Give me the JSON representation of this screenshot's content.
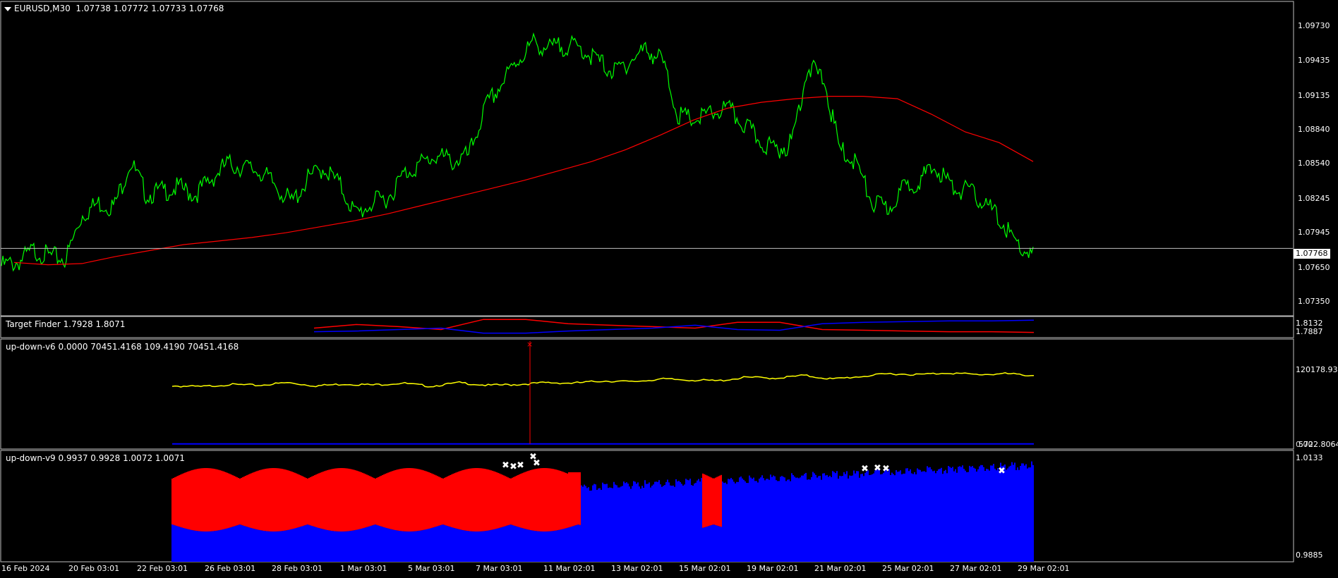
{
  "main": {
    "symbol": "EURUSD,M30",
    "ohlc": "1.07738 1.07772 1.07733 1.07768",
    "current_price": "1.07768",
    "price_ticks": [
      "1.09730",
      "1.09435",
      "1.09135",
      "1.08840",
      "1.08540",
      "1.08245",
      "1.07945",
      "1.07650",
      "1.07350"
    ]
  },
  "target_finder": {
    "label": "Target Finder 1.7928 1.8071",
    "ticks": [
      "1.8132",
      "1.7887"
    ]
  },
  "updown_v6": {
    "label": "up-down-v6 0.0000 70451.4168 109.4190 70451.4168",
    "ticks": [
      "120178.93",
      "5722.8064"
    ],
    "bottom_overlap": "0.00"
  },
  "updown_v9": {
    "label": "up-down-v9 0.9937 0.9928 1.0072 1.0071",
    "ticks": [
      "1.0133",
      "0.9885"
    ]
  },
  "time_axis": [
    "16 Feb 2024",
    "20 Feb 03:01",
    "22 Feb 03:01",
    "26 Feb 03:01",
    "28 Feb 03:01",
    "1 Mar 03:01",
    "5 Mar 03:01",
    "7 Mar 03:01",
    "11 Mar 02:01",
    "13 Mar 02:01",
    "15 Mar 02:01",
    "19 Mar 02:01",
    "21 Mar 02:01",
    "25 Mar 02:01",
    "27 Mar 02:01",
    "29 Mar 02:01"
  ],
  "colors": {
    "price": "#00ff00",
    "ma": "#ff0000",
    "yellow": "#ffff00",
    "blue": "#0000ff",
    "red": "#ff0000",
    "grid": "#c0c0c0"
  },
  "chart_data": [
    {
      "type": "line",
      "title": "EURUSD,M30",
      "ylim": [
        1.072,
        1.0985
      ],
      "series": [
        {
          "values": [
            1.0762,
            1.0765,
            1.0775,
            1.077,
            1.0768,
            1.0805,
            1.0815,
            1.0812,
            1.085,
            1.0822,
            1.0825,
            1.0828,
            1.0822,
            1.0835,
            1.0848,
            1.0845,
            1.0842,
            1.083,
            1.0815,
            1.0835,
            1.0845,
            1.083,
            1.0805,
            1.0815,
            1.082,
            1.084,
            1.0848,
            1.0855,
            1.085,
            1.0855,
            1.0895,
            1.0915,
            1.0935,
            1.095,
            1.0945,
            1.0948,
            1.0945,
            1.0935,
            1.0925,
            1.0935,
            1.0945,
            1.0935,
            1.0888,
            1.0885,
            1.089,
            1.0895,
            1.0882,
            1.0868,
            1.086,
            1.0865,
            1.093,
            1.092,
            1.086,
            1.085,
            1.0815,
            1.081,
            1.0828,
            1.0835,
            1.0845,
            1.0828,
            1.0825,
            1.0815,
            1.08,
            1.078,
            1.077
          ]
        },
        {
          "values": [
            1.0765,
            1.0763,
            1.0764,
            1.077,
            1.0775,
            1.078,
            1.0783,
            1.0786,
            1.079,
            1.0795,
            1.08,
            1.0806,
            1.0813,
            1.082,
            1.0827,
            1.0834,
            1.0842,
            1.085,
            1.086,
            1.0872,
            1.0885,
            1.0895,
            1.09,
            1.0903,
            1.0905,
            1.0905,
            1.0903,
            1.089,
            1.0875,
            1.0866,
            1.085
          ]
        }
      ]
    },
    {
      "type": "line",
      "title": "Target Finder 1.7928 1.8071",
      "ylim": [
        1.7887,
        1.8132
      ],
      "series": [
        {
          "values": [
            1.8,
            1.805,
            1.802,
            1.798,
            1.812,
            1.812,
            1.806,
            1.804,
            1.802,
            1.8,
            1.808,
            1.808,
            1.798,
            1.797,
            1.796,
            1.795,
            1.795,
            1.794
          ]
        },
        {
          "values": [
            1.795,
            1.796,
            1.798,
            1.8,
            1.793,
            1.793,
            1.796,
            1.798,
            1.8,
            1.804,
            1.798,
            1.797,
            1.806,
            1.808,
            1.809,
            1.81,
            1.81,
            1.811
          ]
        }
      ]
    },
    {
      "type": "line",
      "title": "up-down-v6 0.0000 70451.4168 109.4190 70451.4168",
      "ylim": [
        5722.8064,
        120178.93
      ],
      "series": [
        {
          "values": [
            70451,
            69500,
            72000,
            71000,
            74000,
            70500,
            72500,
            71500,
            73500,
            70000,
            74000,
            71000,
            72000,
            74000,
            73500,
            76000,
            75000,
            78000,
            77000,
            76000,
            80000,
            79000,
            82000,
            78000,
            81000,
            84000,
            83000,
            85000,
            83000,
            84000,
            82000
          ]
        },
        {
          "values": [
            5900,
            5900,
            5900,
            5900,
            5900,
            5900,
            5900,
            5900,
            5900,
            5900,
            5900,
            5900,
            5900,
            5900,
            5900,
            5900,
            5900,
            5900,
            5900,
            5900,
            5900,
            5900,
            5900,
            5900,
            5900,
            5900,
            5900,
            5900,
            5900,
            5900,
            5900
          ]
        }
      ]
    },
    {
      "type": "area",
      "title": "up-down-v9 0.9937 0.9928 1.0072 1.0071",
      "ylim": [
        0.9885,
        1.0133
      ]
    }
  ]
}
